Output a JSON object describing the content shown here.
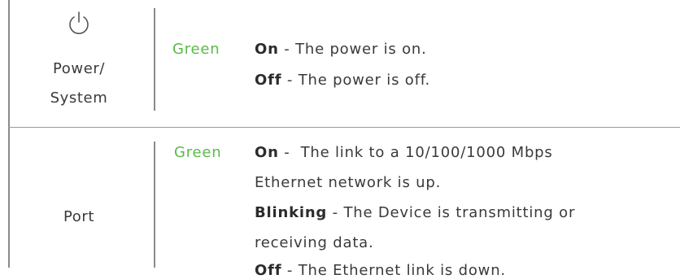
{
  "colors": {
    "accent_green": "#5aba47",
    "text": "#3a3a3a",
    "rule": "#8a8a8a"
  },
  "rows": [
    {
      "icon": "power-icon",
      "label_lines": [
        "Power/",
        "System"
      ],
      "color": "Green",
      "states": [
        {
          "name": "On",
          "sep": " - ",
          "desc": "The power is on."
        },
        {
          "name": "Off",
          "sep": " - ",
          "desc": "The power is off."
        }
      ]
    },
    {
      "label": "Port",
      "color": "Green",
      "states": [
        {
          "name": "On",
          "sep": " -  ",
          "desc": "The link to a 10/100/1000 Mbps",
          "desc_cont": "Ethernet network is up."
        },
        {
          "name": "Blinking",
          "sep": " - ",
          "desc": "The Device is transmitting or",
          "desc_cont": "receiving data."
        },
        {
          "name": "Off",
          "sep": " - ",
          "desc": "The Ethernet link is down."
        }
      ]
    }
  ]
}
